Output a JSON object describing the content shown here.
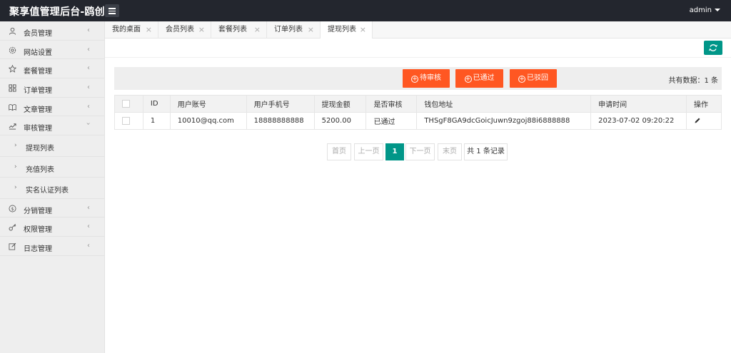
{
  "header": {
    "brand": "聚享值管理后台-鸥创论",
    "user": "admin"
  },
  "sidebar": {
    "items": [
      {
        "label": "会员管理",
        "icon": "user-icon"
      },
      {
        "label": "网站设置",
        "icon": "gear-icon"
      },
      {
        "label": "套餐管理",
        "icon": "star-icon"
      },
      {
        "label": "订单管理",
        "icon": "grid-icon"
      },
      {
        "label": "文章管理",
        "icon": "book-icon"
      },
      {
        "label": "审核管理",
        "icon": "audit-icon"
      }
    ],
    "sub_items": [
      "提现列表",
      "充值列表",
      "实名认证列表"
    ],
    "items_after": [
      {
        "label": "分销管理",
        "icon": "dollar-icon"
      },
      {
        "label": "权限管理",
        "icon": "key-icon"
      },
      {
        "label": "日志管理",
        "icon": "edit-icon"
      }
    ]
  },
  "tabs": [
    "我的桌面",
    "会员列表",
    "套餐列表",
    "订单列表",
    "提现列表"
  ],
  "toolbar": {
    "pending": "待审核",
    "approved": "已通过",
    "rejected": "已驳回",
    "total": "共有数据：1 条"
  },
  "table": {
    "headers": [
      "",
      "ID",
      "用户账号",
      "用户手机号",
      "提现金额",
      "是否审核",
      "钱包地址",
      "申请时间",
      "操作"
    ],
    "rows": [
      [
        "",
        "1",
        "10010@qq.com",
        "18888888888",
        "5200.00",
        "已通过",
        "THSgF8GA9dcGoicJuwn9zgoj88i6888888",
        "2023-07-02 09:20:22",
        ""
      ]
    ]
  },
  "pager": {
    "first": "首页",
    "prev": "上一页",
    "current": "1",
    "next": "下一页",
    "last": "末页",
    "info": "共 1 条记录"
  },
  "colors": {
    "topbar": "#23262e",
    "accent_green": "#009688",
    "accent_orange": "#ff5722"
  }
}
